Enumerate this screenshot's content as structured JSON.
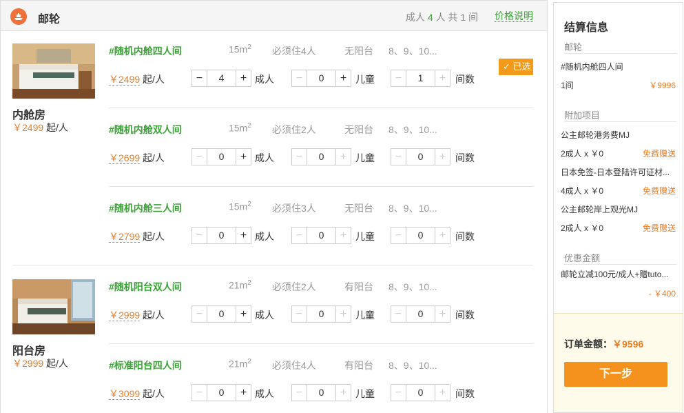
{
  "header": {
    "title": "邮轮",
    "adults_label": "成人",
    "adults_count": "4",
    "adults_unit": "人",
    "total_prefix": "共",
    "total_count": "1",
    "total_unit": "间",
    "price_link": "价格说明"
  },
  "labels": {
    "adult": "成人",
    "child": "儿童",
    "rooms": "间数",
    "per_person": "起/人",
    "selected": "已选"
  },
  "cabins": [
    {
      "type": "内舱房",
      "price": "￥2499",
      "rooms": [
        {
          "name": "#随机内舱四人间",
          "size": "15m",
          "req": "必须住4人",
          "balcony": "无阳台",
          "decks": "8、9、10...",
          "price": "￥2499",
          "adults": "4",
          "children": "0",
          "count": "1"
        },
        {
          "name": "#随机内舱双人间",
          "size": "15m",
          "req": "必须住2人",
          "balcony": "无阳台",
          "decks": "8、9、10...",
          "price": "￥2699",
          "adults": "0",
          "children": "0",
          "count": "0"
        },
        {
          "name": "#随机内舱三人间",
          "size": "15m",
          "req": "必须住3人",
          "balcony": "无阳台",
          "decks": "8、9、10...",
          "price": "￥2799",
          "adults": "0",
          "children": "0",
          "count": "0"
        }
      ]
    },
    {
      "type": "阳台房",
      "price": "￥2999",
      "rooms": [
        {
          "name": "#随机阳台双人间",
          "size": "21m",
          "req": "必须住2人",
          "balcony": "有阳台",
          "decks": "8、9、10...",
          "price": "￥2999",
          "adults": "0",
          "children": "0",
          "count": "0"
        },
        {
          "name": "#标准阳台四人间",
          "size": "21m",
          "req": "必须住4人",
          "balcony": "有阳台",
          "decks": "8、9、10...",
          "price": "￥3099",
          "adults": "0",
          "children": "0",
          "count": "0"
        }
      ]
    }
  ],
  "sidebar": {
    "title": "结算信息",
    "cruise_section": "邮轮",
    "cruise_item": "#随机内舱四人间",
    "cruise_qty": "1间",
    "cruise_price": "￥9996",
    "addons_section": "附加项目",
    "addons": [
      {
        "name": "公主邮轮港务费MJ",
        "qty": "2成人 x ￥0",
        "note": "免费赠送"
      },
      {
        "name": "日本免签-日本登陆许可证材...",
        "qty": "4成人 x ￥0",
        "note": "免费赠送"
      },
      {
        "name": "公主邮轮岸上观光MJ",
        "qty": "2成人 x ￥0",
        "note": "免费赠送"
      }
    ],
    "discount_section": "优惠金额",
    "discount_item": "邮轮立减100元/成人+赠tuto...",
    "discount_amount": "- ￥400",
    "total_label": "订单金额：",
    "total_amount": "￥9596",
    "next_button": "下一步"
  }
}
